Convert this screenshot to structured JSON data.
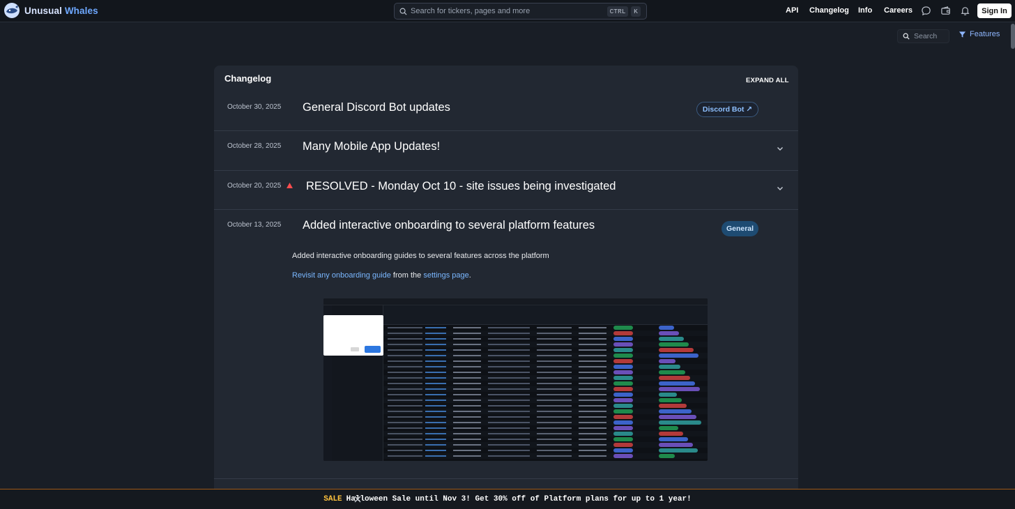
{
  "brand": {
    "name_part1": "Unusual",
    "name_part2": "Whales",
    "logo_icon": "whale-logo-icon"
  },
  "search": {
    "placeholder": "Search for tickers, pages and more",
    "kbd_ctrl": "CTRL",
    "kbd_k": "K"
  },
  "nav": {
    "links": [
      "API",
      "Changelog",
      "Info",
      "Careers"
    ],
    "icons": [
      "chat-icon",
      "wallet-icon",
      "bell-icon"
    ],
    "signin": "Sign In"
  },
  "toolbar": {
    "search_placeholder": "Search",
    "features_label": "Features",
    "features_icon": "filter-icon"
  },
  "changelog": {
    "title": "Changelog",
    "expand_all": "EXPAND ALL",
    "entries": [
      {
        "date": "October 30, 2025",
        "title": "General Discord Bot updates",
        "tag": "Discord Bot ↗"
      },
      {
        "date": "October 28, 2025",
        "title": "Many Mobile App Updates!"
      },
      {
        "date": "October 20, 2025",
        "title": "RESOLVED - Monday Oct 10 - site issues being investigated",
        "alert": true
      },
      {
        "date": "October 13, 2025",
        "title": "Added interactive onboarding to several platform features",
        "tag": "General",
        "body": {
          "line1": "Added interactive onboarding guides to several features across the platform",
          "link1": "Revisit any onboarding guide",
          "mid": " from the ",
          "link2": "settings page",
          "end": "."
        }
      }
    ]
  },
  "sale_bar": {
    "label": "SALE",
    "text": "Halloween Sale until Nov 3! Get 30% off of Platform plans for up to 1 year!"
  },
  "colors": {
    "accent": "#7ab7ff",
    "sale": "#ffc23d",
    "alert": "#ff4d4f",
    "general_badge": "#1e4b72"
  }
}
